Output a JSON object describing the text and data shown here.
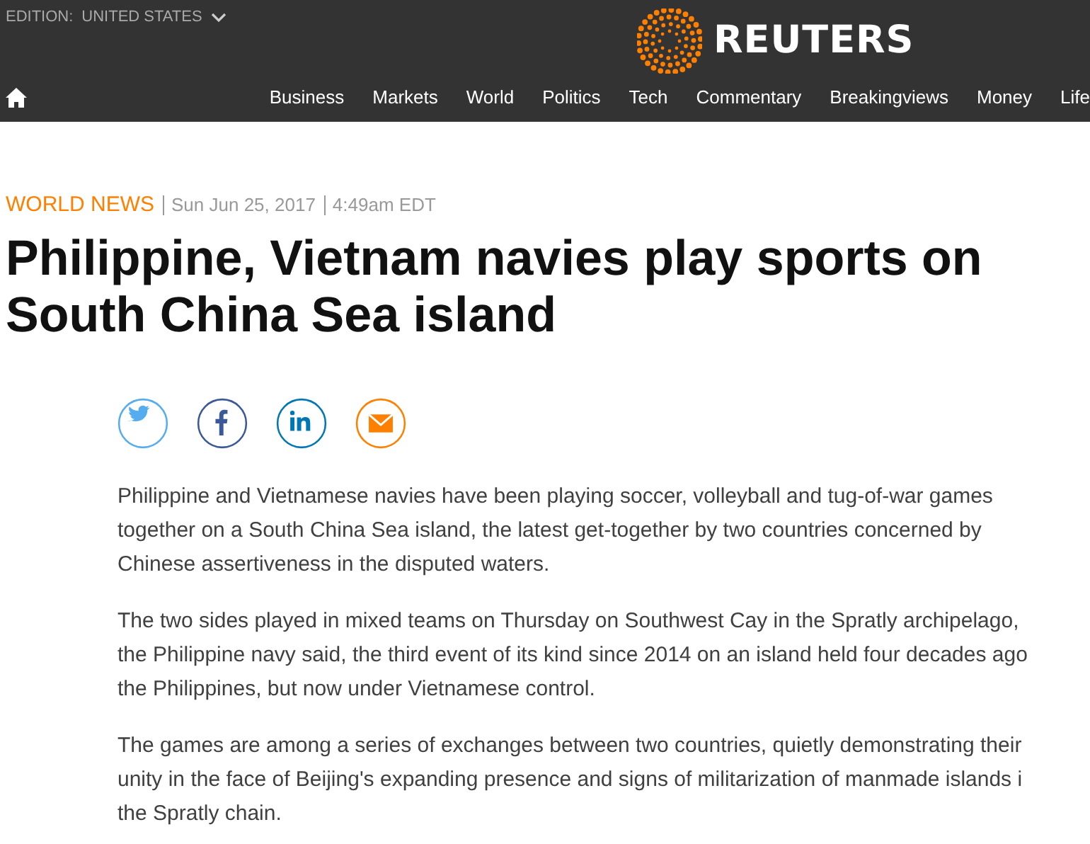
{
  "header": {
    "edition_label": "EDITION:",
    "edition_value": "UNITED STATES",
    "logo_text": "REUTERS",
    "nav": [
      "Business",
      "Markets",
      "World",
      "Politics",
      "Tech",
      "Commentary",
      "Breakingviews",
      "Money",
      "Life"
    ]
  },
  "article": {
    "section": "WORLD NEWS",
    "date": "Sun Jun 25, 2017",
    "time": "4:49am EDT",
    "title": "Philippine, Vietnam navies play sports on South China Sea island",
    "share": [
      {
        "kind": "twitter"
      },
      {
        "kind": "facebook"
      },
      {
        "kind": "linkedin"
      },
      {
        "kind": "email"
      }
    ],
    "paragraphs": [
      [
        "Philippine and Vietnamese navies have been playing soccer, volleyball and tug-of-war games",
        "together on a South China Sea island, the latest get-together by two countries concerned by",
        "Chinese assertiveness in the disputed waters."
      ],
      [
        "The two sides played in mixed teams on Thursday on Southwest Cay in the Spratly archipelago,",
        "the Philippine navy said, the third event of its kind since 2014 on an island held four decades ago",
        "the Philippines, but now under Vietnamese control."
      ],
      [
        "The games are among a series of exchanges between two countries, quietly demonstrating their",
        "unity in the face of Beijing's expanding presence and signs of militarization of manmade islands i",
        "the Spratly chain."
      ]
    ]
  }
}
